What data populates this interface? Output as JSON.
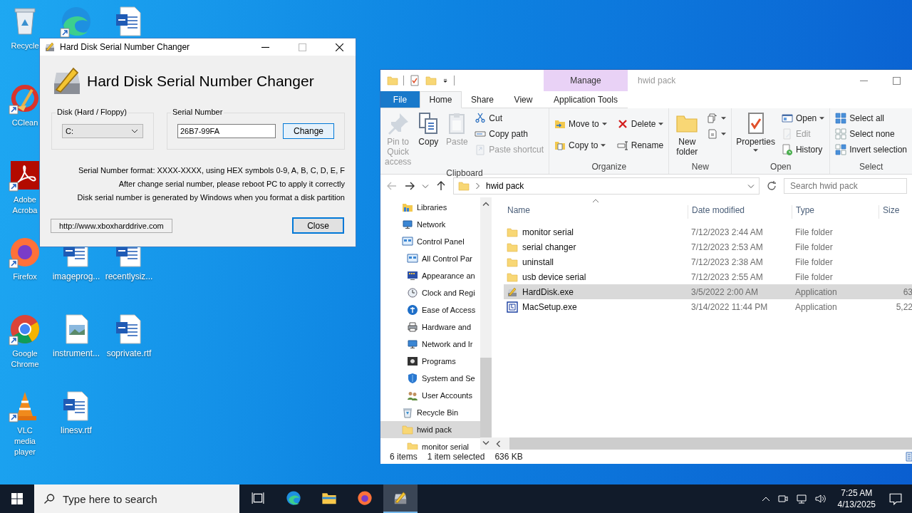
{
  "desktop": {
    "columns": [
      [
        {
          "kind": "recyclebin",
          "label": "Recycle",
          "shortcut": false
        },
        {
          "kind": "ccleaner",
          "label": "CClean",
          "shortcut": true
        },
        {
          "kind": "acrobat",
          "label": "Adobe Acroba",
          "shortcut": true
        },
        {
          "kind": "firefox",
          "label": "Firefox",
          "shortcut": true
        },
        {
          "kind": "chrome",
          "label": "Google Chrome",
          "shortcut": true
        },
        {
          "kind": "vlc",
          "label": "VLC media player",
          "shortcut": true
        }
      ],
      [
        {
          "kind": "edge",
          "shortcut": true
        },
        {
          "kind": "word",
          "label": "imageprog...",
          "shortcut": false
        },
        {
          "kind": "image",
          "label": "instrument...",
          "shortcut": false
        },
        {
          "kind": "word",
          "label": "linesv.rtf",
          "shortcut": false
        }
      ],
      [
        {
          "kind": "word",
          "shortcut": false
        },
        {
          "kind": "word",
          "label": "recentlysiz...",
          "shortcut": false
        },
        {
          "kind": "word",
          "label": "soprivate.rtf",
          "shortcut": false
        }
      ]
    ]
  },
  "dialog": {
    "title": "Hard Disk Serial Number Changer",
    "heading": "Hard Disk Serial Number Changer",
    "disk_group": {
      "legend": "Disk (Hard / Floppy)",
      "value": "C:"
    },
    "serial_group": {
      "legend": "Serial Number",
      "value": "26B7-99FA",
      "button": "Change"
    },
    "notes": [
      "Serial Number format: XXXX-XXXX, using HEX symbols 0-9, A, B, C, D, E, F",
      "After change serial number, please reboot PC to apply it correctly",
      "Disk serial number is generated by Windows when you format a disk partition"
    ],
    "link": "http://www.xboxharddrive.com",
    "close_button": "Close"
  },
  "explorer": {
    "title": "hwid pack",
    "context_tab": "Manage",
    "tabs": [
      {
        "label": "File",
        "kind": "file",
        "selected": false
      },
      {
        "label": "Home",
        "kind": "normal",
        "selected": true
      },
      {
        "label": "Share",
        "kind": "normal",
        "selected": false
      },
      {
        "label": "View",
        "kind": "normal",
        "selected": false
      },
      {
        "label": "Application Tools",
        "kind": "normal",
        "selected": false
      }
    ],
    "ribbon": [
      {
        "label": "Clipboard",
        "kind": "stack3",
        "large": [
          {
            "label": "Pin to Quick access",
            "kind": "pin",
            "disabled": true,
            "dropdown": false
          },
          {
            "label": "Copy",
            "kind": "copy",
            "disabled": false,
            "dropdown": false
          },
          {
            "label": "Paste",
            "kind": "paste",
            "disabled": true,
            "dropdown": false
          }
        ],
        "small": [
          {
            "label": "Cut",
            "kind": "cut",
            "disabled": false,
            "dropdown": false
          },
          {
            "label": "Copy path",
            "kind": "path",
            "disabled": false,
            "dropdown": false
          },
          {
            "label": "Paste shortcut",
            "kind": "shortcut",
            "disabled": true,
            "dropdown": false
          }
        ]
      },
      {
        "label": "Organize",
        "kind": "stack2",
        "small": [
          {
            "label": "Move to",
            "kind": "move",
            "disabled": false,
            "dropdown": true
          },
          {
            "label": "Copy to",
            "kind": "copyto",
            "disabled": false,
            "dropdown": true
          },
          {
            "label": "Delete",
            "kind": "delete",
            "disabled": false,
            "dropdown": true
          },
          {
            "label": "Rename",
            "kind": "rename",
            "disabled": false,
            "dropdown": false
          }
        ]
      },
      {
        "label": "New",
        "kind": "stack3",
        "large": [
          {
            "label": "New folder",
            "kind": "folder",
            "disabled": false,
            "dropdown": false
          }
        ],
        "small": [
          {
            "kind": "newitem",
            "disabled": false,
            "dropdown": true
          },
          {
            "kind": "access",
            "disabled": false,
            "dropdown": true
          }
        ]
      },
      {
        "label": "Open",
        "kind": "stack3",
        "large": [
          {
            "label": "Properties",
            "kind": "properties",
            "disabled": false,
            "dropdown": true
          }
        ],
        "small": [
          {
            "label": "Open",
            "kind": "open",
            "disabled": false,
            "dropdown": true
          },
          {
            "label": "Edit",
            "kind": "edit",
            "disabled": true,
            "dropdown": false
          },
          {
            "label": "History",
            "kind": "history",
            "disabled": false,
            "dropdown": false
          }
        ]
      },
      {
        "label": "Select",
        "kind": "stack3",
        "small": [
          {
            "label": "Select all",
            "kind": "selectall",
            "disabled": false,
            "dropdown": false
          },
          {
            "label": "Select none",
            "kind": "selectnone",
            "disabled": false,
            "dropdown": false
          },
          {
            "label": "Invert selection",
            "kind": "invert",
            "disabled": false,
            "dropdown": false
          }
        ]
      }
    ],
    "address": "hwid pack",
    "search_placeholder": "Search hwid pack",
    "nav": [
      {
        "label": "Libraries",
        "kind": "library",
        "selected": false
      },
      {
        "label": "Network",
        "kind": "network",
        "selected": false
      },
      {
        "label": "Control Panel",
        "kind": "panel",
        "selected": false,
        "children": [
          {
            "label": "All Control Par",
            "kind": "panel",
            "selected": false
          },
          {
            "label": "Appearance an",
            "kind": "appearance",
            "selected": false
          },
          {
            "label": "Clock and Regi",
            "kind": "clock",
            "selected": false
          },
          {
            "label": "Ease of Access",
            "kind": "ease",
            "selected": false
          },
          {
            "label": "Hardware and",
            "kind": "hardware",
            "selected": false
          },
          {
            "label": "Network and Ir",
            "kind": "network",
            "selected": false
          },
          {
            "label": "Programs",
            "kind": "programs",
            "selected": false
          },
          {
            "label": "System and Se",
            "kind": "shield",
            "selected": false
          },
          {
            "label": "User Accounts",
            "kind": "users",
            "selected": false
          }
        ]
      },
      {
        "label": "Recycle Bin",
        "kind": "recycle",
        "selected": false
      },
      {
        "label": "hwid pack",
        "kind": "folder",
        "selected": true,
        "children": [
          {
            "label": "monitor serial",
            "kind": "folder",
            "selected": false
          }
        ]
      }
    ],
    "columns": [
      "Name",
      "Date modified",
      "Type",
      "Size"
    ],
    "files": [
      {
        "name": "monitor serial",
        "kind": "folder",
        "date": "7/12/2023 2:44 AM",
        "type": "File folder",
        "selected": false
      },
      {
        "name": "serial changer",
        "kind": "folder",
        "date": "7/12/2023 2:53 AM",
        "type": "File folder",
        "selected": false
      },
      {
        "name": "uninstall",
        "kind": "folder",
        "date": "7/12/2023 2:38 AM",
        "type": "File folder",
        "selected": false
      },
      {
        "name": "usb device serial",
        "kind": "folder",
        "date": "7/12/2023 2:55 AM",
        "type": "File folder",
        "selected": false
      },
      {
        "name": "HardDisk.exe",
        "kind": "harddisk",
        "date": "3/5/2022 2:00 AM",
        "type": "Application",
        "size": "63",
        "selected": true
      },
      {
        "name": "MacSetup.exe",
        "kind": "maze",
        "date": "3/14/2022 11:44 PM",
        "type": "Application",
        "size": "5,22",
        "selected": false
      }
    ],
    "status": [
      "6 items",
      "1 item selected",
      "636 KB"
    ]
  },
  "taskbar": {
    "search_placeholder": "Type here to search",
    "apps": [
      {
        "kind": "edge",
        "active": false
      },
      {
        "kind": "explorer",
        "active": false
      },
      {
        "kind": "firefox",
        "active": false
      },
      {
        "kind": "harddisk",
        "active": true
      }
    ],
    "time": "7:25 AM",
    "date": "4/13/2025"
  }
}
